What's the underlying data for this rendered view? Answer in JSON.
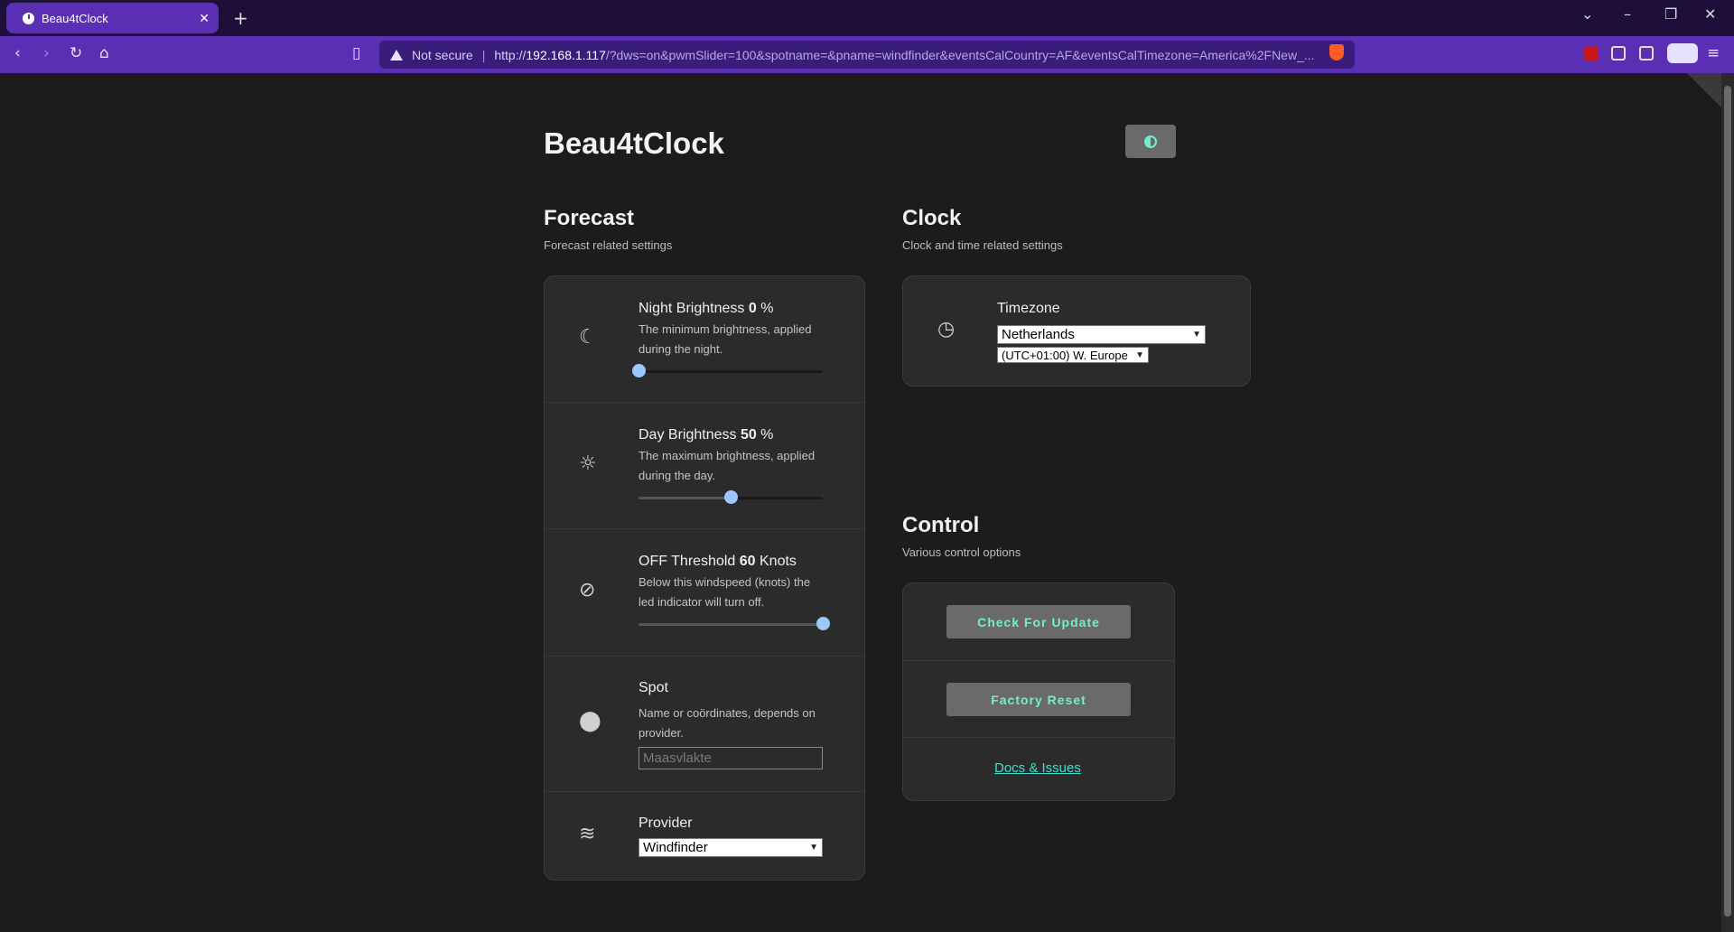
{
  "browser": {
    "tab_title": "Beau4tClock",
    "tab_close": "✕",
    "new_tab": "+",
    "not_secure": "Not secure",
    "url_scheme": "http://",
    "url_host": "192.168.1.117",
    "url_path": "/?dws=on&pwmSlider=100&spotname=&pname=windfinder&eventsCalCountry=AF&eventsCalTimezone=America%2FNew_..."
  },
  "app": {
    "title": "Beau4tClock"
  },
  "forecast": {
    "title": "Forecast",
    "subtitle": "Forecast related settings",
    "night": {
      "label": "Night Brightness ",
      "value": "0",
      "unit": " %",
      "desc": "The minimum brightness, applied during the night.",
      "fraction": 0.0
    },
    "day": {
      "label": "Day Brightness ",
      "value": "50",
      "unit": " %",
      "desc": "The maximum brightness, applied during the day.",
      "fraction": 0.5
    },
    "threshold": {
      "label": "OFF Threshold ",
      "value": "60",
      "unit": " Knots",
      "desc": "Below this windspeed (knots) the led indicator will turn off.",
      "fraction": 1.0
    },
    "spot": {
      "label": "Spot",
      "desc": "Name or coördinates, depends on provider.",
      "placeholder": "Maasvlakte"
    },
    "provider": {
      "label": "Provider",
      "selected": "Windfinder"
    }
  },
  "clock": {
    "title": "Clock",
    "subtitle": "Clock and time related settings",
    "timezone_label": "Timezone",
    "country_selected": "Netherlands",
    "tz_selected": "(UTC+01:00) W. Europe"
  },
  "control": {
    "title": "Control",
    "subtitle": "Various control options",
    "check_update": "Check For Update",
    "factory_reset": "Factory Reset",
    "docs_link": "Docs & Issues"
  },
  "colors": {
    "accent": "#6ef0d0",
    "knob": "#9cc8ff",
    "browser_purple": "#5b2fb4"
  }
}
